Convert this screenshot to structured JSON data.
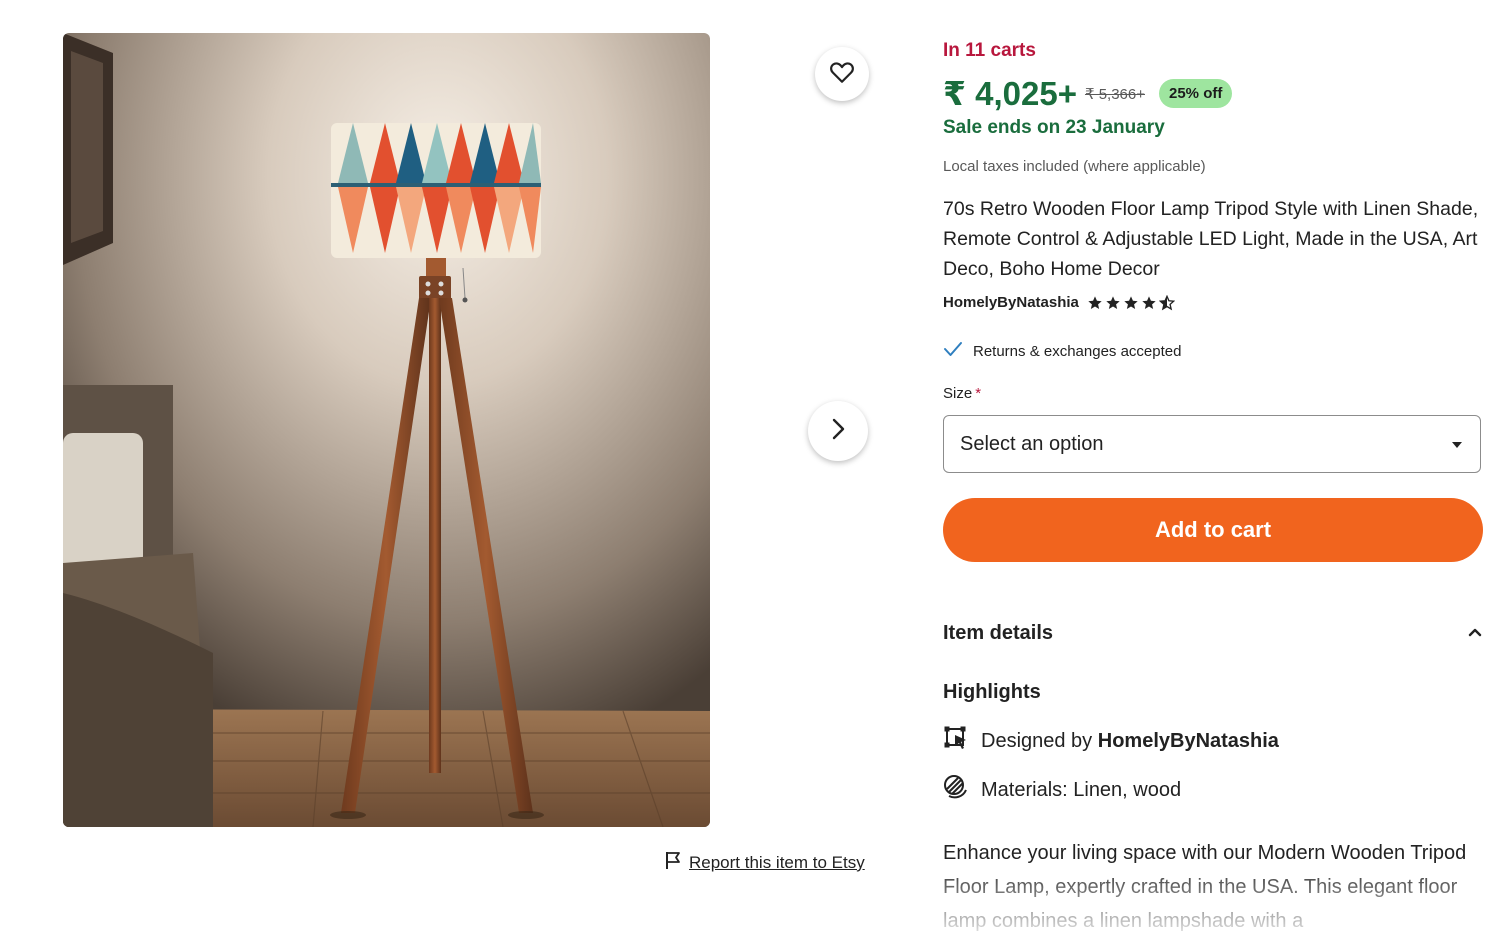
{
  "listing": {
    "in_carts": "In 11 carts",
    "price": "₹ 4,025+",
    "original_price": "₹ 5,366+",
    "discount_badge": "25% off",
    "sale_ends": "Sale ends on 23 January",
    "taxes_note": "Local taxes included (where applicable)",
    "title": "70s Retro Wooden Floor Lamp Tripod Style with Linen Shade, Remote Control & Adjustable LED Light, Made in the USA, Art Deco, Boho Home Decor",
    "shop_name": "HomelyByNatashia",
    "rating": 4.5,
    "returns_text": "Returns & exchanges accepted"
  },
  "size": {
    "label": "Size",
    "required_mark": "*",
    "selected": "Select an option"
  },
  "actions": {
    "add_to_cart": "Add to cart",
    "report": "Report this item to Etsy"
  },
  "details": {
    "header": "Item details",
    "highlights_title": "Highlights",
    "designed_by_prefix": "Designed by",
    "designed_by_shop": "HomelyByNatashia",
    "materials": "Materials: Linen, wood",
    "description": "Enhance your living space with our Modern Wooden Tripod Floor Lamp, expertly crafted in the USA. This elegant floor lamp combines a linen lampshade with a"
  },
  "colors": {
    "sale_green": "#1a6d3d",
    "carts_red": "#b8173d",
    "badge_green": "#9ee59f",
    "cta_orange": "#f1641e"
  },
  "icons": {
    "favorite": "heart-icon",
    "next": "chevron-right-icon",
    "report": "flag-icon",
    "returns": "checkmark-icon",
    "dropdown": "caret-down-icon",
    "collapse": "chevron-up-icon",
    "designed": "design-tool-icon",
    "materials": "materials-icon"
  }
}
